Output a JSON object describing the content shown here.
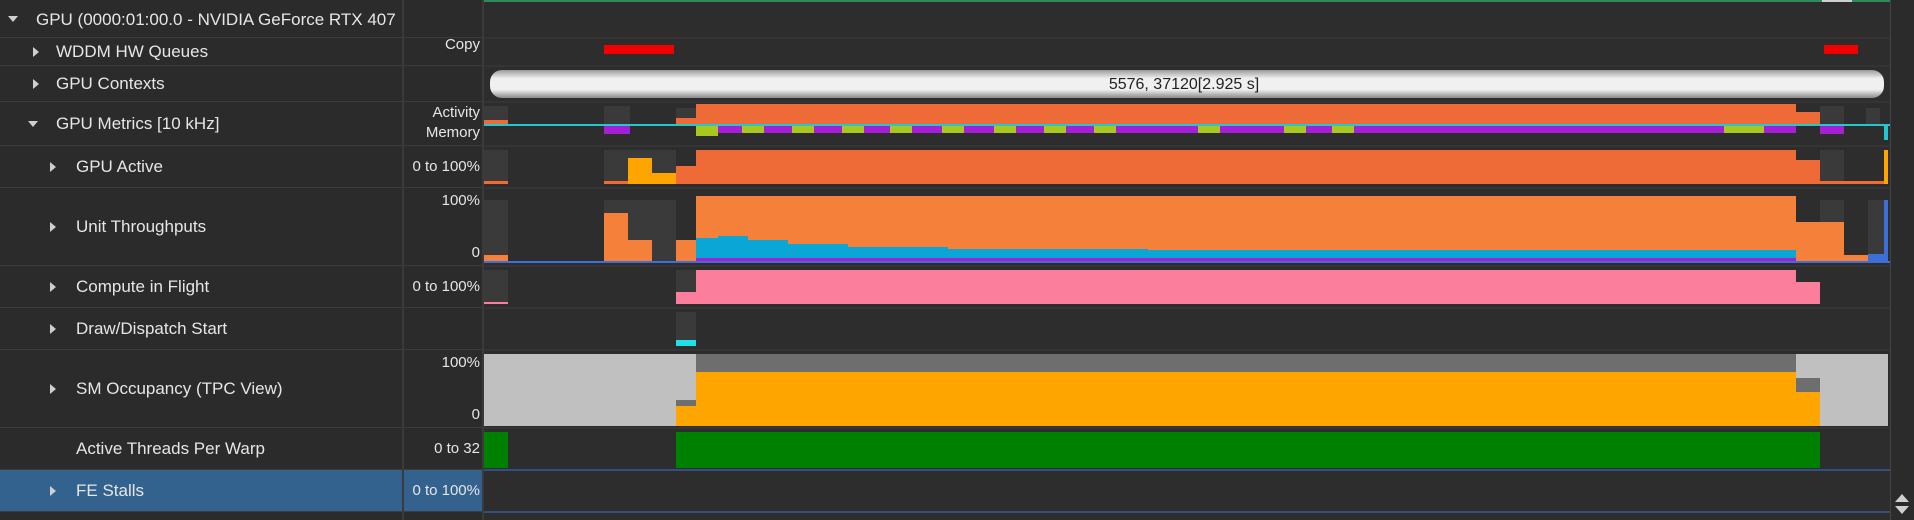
{
  "tree": {
    "gpu_title": "GPU (0000:01:00.0 - NVIDIA GeForce RTX 407",
    "rows": [
      {
        "label": "WDDM HW Queues"
      },
      {
        "label": "GPU Contexts"
      },
      {
        "label": "GPU Metrics [10 kHz]"
      },
      {
        "label": "GPU Active"
      },
      {
        "label": "Unit Throughputs"
      },
      {
        "label": "Compute in Flight"
      },
      {
        "label": "Draw/Dispatch Start"
      },
      {
        "label": "SM Occupancy (TPC View)"
      },
      {
        "label": "Active Threads Per Warp"
      },
      {
        "label": "FE Stalls"
      }
    ]
  },
  "scale": {
    "wddm": "Copy",
    "metrics_activity": "Activity",
    "metrics_memory": "Memory",
    "gpu_active": "0 to 100%",
    "unit_top": "100%",
    "unit_bottom": "0",
    "compute": "0 to 100%",
    "sm_top": "100%",
    "sm_bottom": "0",
    "threads": "0 to 32",
    "fe_stalls": "0 to 100%"
  },
  "timeline": {
    "context_range_label": "5576, 37120[2.925 s]"
  },
  "colors": {
    "orange": "#ee6a36",
    "unit_orange": "#f4803a",
    "cyan_blue": "#0aa7d6",
    "purple": "#a61fd6",
    "lime": "#a8c820",
    "pink": "#fb7f9c",
    "amber": "#ffa500",
    "gray_light": "#c0c0c0",
    "gray_mid": "#6e6e6e",
    "green": "#008000",
    "red": "#f00000",
    "cyan": "#20e0e8",
    "selected": "#33628e"
  }
}
